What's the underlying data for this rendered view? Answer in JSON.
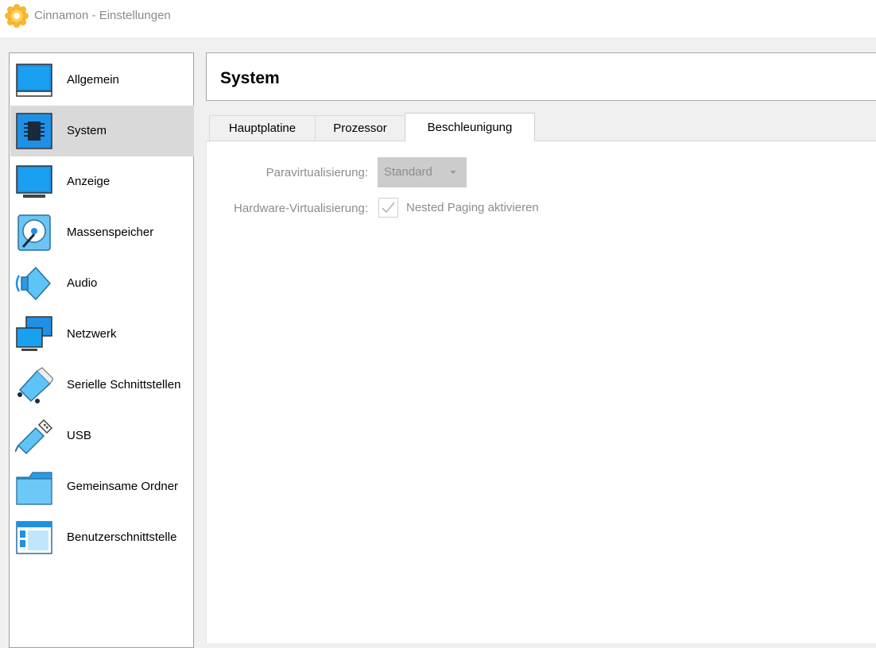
{
  "window": {
    "title": "Cinnamon - Einstellungen",
    "icon": "gear-app-icon"
  },
  "sidebar": {
    "items": [
      {
        "label": "Allgemein",
        "icon": "general-icon"
      },
      {
        "label": "System",
        "icon": "system-chip-icon",
        "selected": true
      },
      {
        "label": "Anzeige",
        "icon": "display-icon"
      },
      {
        "label": "Massenspeicher",
        "icon": "storage-icon"
      },
      {
        "label": "Audio",
        "icon": "speaker-icon"
      },
      {
        "label": "Netzwerk",
        "icon": "network-icon"
      },
      {
        "label": "Serielle Schnittstellen",
        "icon": "serial-port-icon"
      },
      {
        "label": "USB",
        "icon": "usb-icon"
      },
      {
        "label": "Gemeinsame Ordner",
        "icon": "folder-icon"
      },
      {
        "label": "Benutzerschnittstelle",
        "icon": "user-interface-icon"
      }
    ]
  },
  "main": {
    "title": "System",
    "tabs": [
      {
        "label": "Hauptplatine"
      },
      {
        "label": "Prozessor"
      },
      {
        "label": "Beschleunigung",
        "active": true
      }
    ],
    "form": {
      "paravirt_label": "Paravirtualisierung:",
      "paravirt_value": "Standard",
      "hwvirt_label": "Hardware-Virtualisierung:",
      "nested_paging_label": "Nested Paging aktivieren",
      "nested_paging_checked": true
    }
  },
  "colors": {
    "accent_blue": "#1e90e6",
    "selected_bg": "#d9d9d9",
    "disabled_text": "#8c8c8c"
  }
}
